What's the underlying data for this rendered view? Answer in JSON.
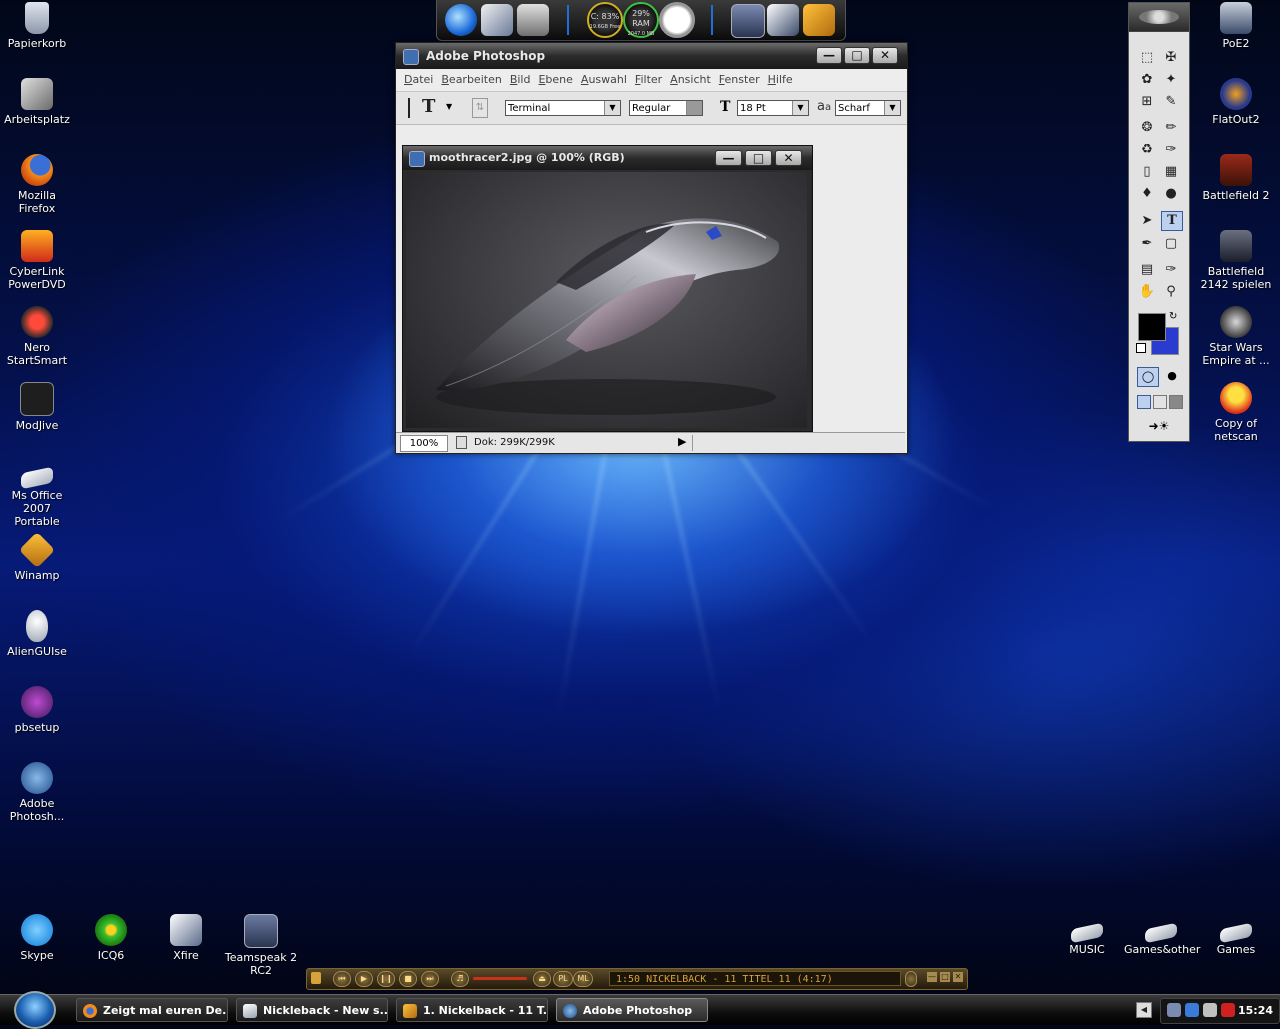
{
  "desktop_icons_left": [
    {
      "label": "Papierkorb",
      "icon": "recycle-bin-icon"
    },
    {
      "label": "Arbeitsplatz",
      "icon": "computer-icon"
    },
    {
      "label": "Mozilla Firefox",
      "icon": "firefox-icon"
    },
    {
      "label": "CyberLink PowerDVD",
      "icon": "powerdvd-icon"
    },
    {
      "label": "Nero StartSmart",
      "icon": "nero-icon"
    },
    {
      "label": "ModJive",
      "icon": "modjive-icon"
    },
    {
      "label": "Ms Office 2007 Portable",
      "icon": "office-icon"
    },
    {
      "label": "Winamp",
      "icon": "winamp-icon"
    },
    {
      "label": "AlienGUIse",
      "icon": "alienguise-icon"
    },
    {
      "label": "pbsetup",
      "icon": "pbsetup-icon"
    },
    {
      "label": "Adobe Photosh...",
      "icon": "photoshop-icon"
    }
  ],
  "desktop_icons_right": [
    {
      "label": "PoE2",
      "icon": "poe2-icon"
    },
    {
      "label": "FlatOut2",
      "icon": "flatout2-icon"
    },
    {
      "label": "Battlefield 2",
      "icon": "battlefield2-icon"
    },
    {
      "label": "Battlefield 2142 spielen",
      "icon": "battlefield2142-icon"
    },
    {
      "label": "Star Wars Empire at ...",
      "icon": "starwars-icon"
    },
    {
      "label": "Copy of netscan",
      "icon": "netscan-icon"
    }
  ],
  "desktop_icons_bottom_left": [
    {
      "label": "Skype",
      "icon": "skype-icon"
    },
    {
      "label": "ICQ6",
      "icon": "icq-icon"
    },
    {
      "label": "Xfire",
      "icon": "xfire-icon"
    },
    {
      "label": "Teamspeak 2 RC2",
      "icon": "teamspeak-icon"
    }
  ],
  "desktop_icons_bottom_right": [
    {
      "label": "MUSIC",
      "icon": "folder-icon"
    },
    {
      "label": "Games&other",
      "icon": "folder-icon"
    },
    {
      "label": "Games",
      "icon": "folder-icon"
    }
  ],
  "top_dock": {
    "cpu_gauge": {
      "line1": "C: 83%",
      "line2": "19.6GB Free"
    },
    "ram_gauge": {
      "line1": "29%",
      "line2": "RAM",
      "line3": "2047.0 MB"
    }
  },
  "photoshop": {
    "title": "Adobe Photoshop",
    "menu": [
      "Datei",
      "Bearbeiten",
      "Bild",
      "Ebene",
      "Auswahl",
      "Filter",
      "Ansicht",
      "Fenster",
      "Hilfe"
    ],
    "options": {
      "tool_glyph": "T",
      "font_family": "Terminal",
      "font_style": "Regular",
      "font_size": "18 Pt",
      "antialias_label": "a",
      "antialias_label_small": "a",
      "antialias": "Scharf"
    },
    "document": {
      "title": "moothracer2.jpg @ 100% (RGB)",
      "zoom": "100%",
      "doc_info": "Dok: 299K/299K"
    }
  },
  "player": {
    "display": "1:50  NICKELBACK - 11 TITEL 11 (4:17)",
    "pl_label": "PL",
    "ml_label": "ML"
  },
  "taskbar": {
    "tasks": [
      {
        "label": "Zeigt mal euren De...",
        "icon": "firefox-icon"
      },
      {
        "label": "Nickleback - New s...",
        "icon": "folder-icon"
      },
      {
        "label": "1. Nickelback - 11 T...",
        "icon": "winamp-icon"
      },
      {
        "label": "Adobe Photoshop",
        "icon": "photoshop-icon"
      }
    ],
    "clock": "15:24"
  },
  "colors": {
    "foreground_swatch": "#000000",
    "background_swatch": "#2a3bd0"
  }
}
